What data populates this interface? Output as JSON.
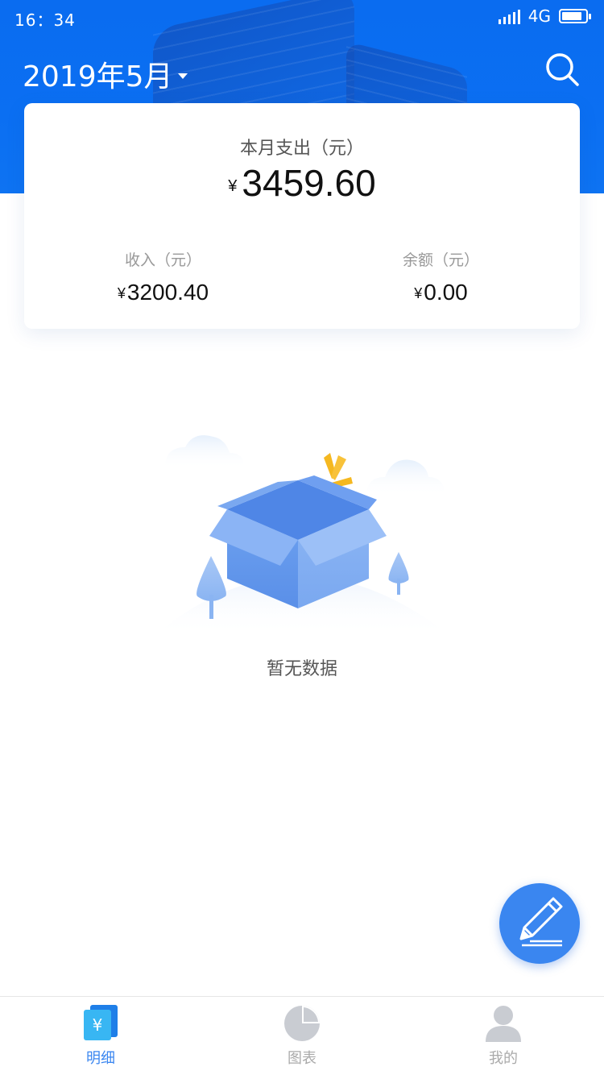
{
  "status_bar": {
    "time": "16：34",
    "network": "4G",
    "battery_level": 0.85
  },
  "header": {
    "month_label": "2019年5月",
    "search_icon": "search-icon"
  },
  "summary": {
    "expense_label": "本月支出（元）",
    "currency": "¥",
    "expense_value": "3459.60",
    "income_label": "收入（元）",
    "income_value": "3200.40",
    "balance_label": "余额（元）",
    "balance_value": "0.00"
  },
  "empty_state": {
    "text": "暂无数据",
    "icon": "empty-box-illustration"
  },
  "fab": {
    "icon": "pencil-icon"
  },
  "tabs": [
    {
      "label": "明细",
      "icon": "wallet-icon",
      "active": true
    },
    {
      "label": "图表",
      "icon": "pie-chart-icon",
      "active": false
    },
    {
      "label": "我的",
      "icon": "user-icon",
      "active": false
    }
  ],
  "colors": {
    "primary": "#0b6ff2",
    "accent": "#3a86f0",
    "inactive": "#aaaaaa"
  }
}
